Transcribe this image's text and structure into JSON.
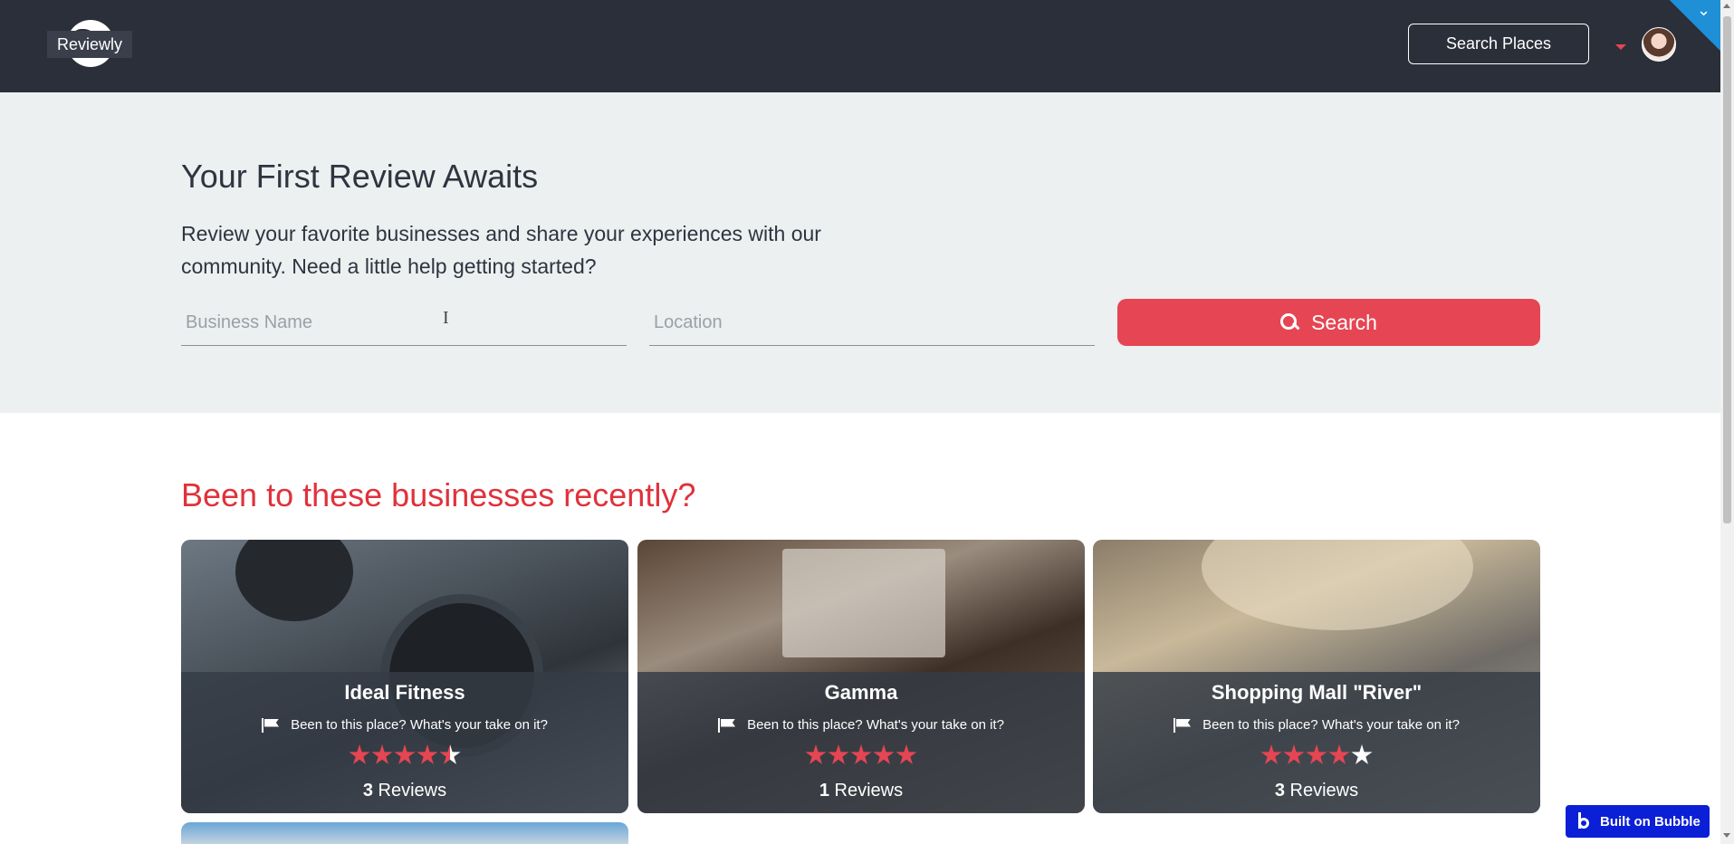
{
  "header": {
    "logo_text": "Reviewly",
    "search_places_label": "Search Places"
  },
  "hero": {
    "title": "Your First Review Awaits",
    "description": "Review your favorite businesses and share your experiences with our community. Need a little help getting started?",
    "business_placeholder": "Business Name",
    "location_placeholder": "Location",
    "business_value": "",
    "location_value": "",
    "search_label": "Search"
  },
  "section": {
    "title": "Been to these businesses recently?"
  },
  "cards": [
    {
      "name": "Ideal Fitness",
      "prompt": "Been to this place? What's your take on it?",
      "rating": 4.5,
      "review_count": "3",
      "review_label": "Reviews"
    },
    {
      "name": "Gamma",
      "prompt": "Been to this place? What's your take on it?",
      "rating": 5,
      "review_count": "1",
      "review_label": "Reviews"
    },
    {
      "name": "Shopping Mall \"River\"",
      "prompt": "Been to this place? What's your take on it?",
      "rating": 4,
      "review_count": "3",
      "review_label": "Reviews"
    }
  ],
  "badge": {
    "label": "Built on Bubble"
  },
  "colors": {
    "header_bg": "#2b2f39",
    "accent": "#e64553",
    "section_title": "#e0323b",
    "hero_bg": "#ecf0f0",
    "badge_bg": "#0a1fd6"
  }
}
